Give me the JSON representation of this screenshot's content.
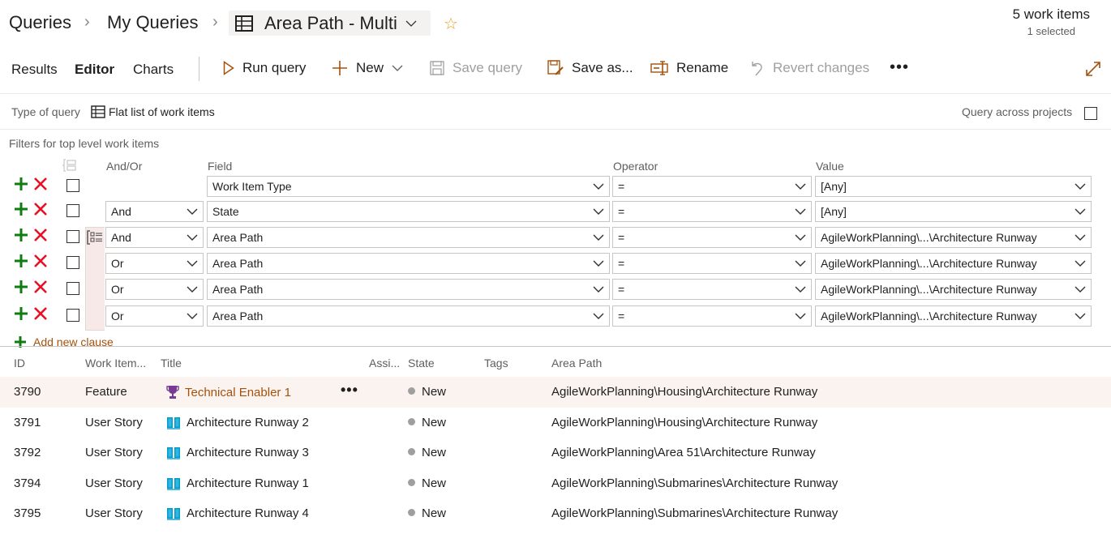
{
  "header": {
    "breadcrumb": [
      "Queries",
      "My Queries"
    ],
    "query_name": "Area Path - Multi",
    "query_icon": "table-icon",
    "favorite_icon": "star-icon",
    "work_item_count": "5 work items",
    "selected_count": "1 selected"
  },
  "toolbar": {
    "tabs": [
      {
        "label": "Results",
        "active": false
      },
      {
        "label": "Editor",
        "active": true
      },
      {
        "label": "Charts",
        "active": false
      }
    ],
    "run_query": "Run query",
    "new": "New",
    "save_query": "Save query",
    "save_as": "Save as...",
    "rename": "Rename",
    "revert_changes": "Revert changes",
    "more": "•••",
    "accent_color": "#a4510b"
  },
  "query_type": {
    "label": "Type of query",
    "value": "Flat list of work items",
    "across_projects_label": "Query across projects",
    "across_projects_checked": false
  },
  "filters": {
    "section_label": "Filters for top level work items",
    "columns": {
      "andor": "And/Or",
      "field": "Field",
      "operator": "Operator",
      "value": "Value"
    },
    "clauses": [
      {
        "andor": "",
        "field": "Work Item Type",
        "operator": "=",
        "value": "[Any]",
        "grouped": false
      },
      {
        "andor": "And",
        "field": "State",
        "operator": "=",
        "value": "[Any]",
        "grouped": false
      },
      {
        "andor": "And",
        "field": "Area Path",
        "operator": "=",
        "value": "AgileWorkPlanning\\...\\Architecture Runway",
        "grouped": true
      },
      {
        "andor": "Or",
        "field": "Area Path",
        "operator": "=",
        "value": "AgileWorkPlanning\\...\\Architecture Runway",
        "grouped": true
      },
      {
        "andor": "Or",
        "field": "Area Path",
        "operator": "=",
        "value": "AgileWorkPlanning\\...\\Architecture Runway",
        "grouped": true
      },
      {
        "andor": "Or",
        "field": "Area Path",
        "operator": "=",
        "value": "AgileWorkPlanning\\...\\Architecture Runway",
        "grouped": true
      }
    ],
    "add_clause": "Add new clause"
  },
  "results": {
    "columns": [
      "ID",
      "Work Item...",
      "Title",
      "Assi...",
      "State",
      "Tags",
      "Area Path"
    ],
    "rows": [
      {
        "id": "3790",
        "type": "Feature",
        "title": "Technical Enabler 1",
        "icon": "trophy-icon",
        "assigned": "",
        "state": "New",
        "tags": "",
        "area_path": "AgileWorkPlanning\\Housing\\Architecture Runway",
        "selected": true
      },
      {
        "id": "3791",
        "type": "User Story",
        "title": "Architecture Runway 2",
        "icon": "book-icon",
        "assigned": "",
        "state": "New",
        "tags": "",
        "area_path": "AgileWorkPlanning\\Housing\\Architecture Runway",
        "selected": false
      },
      {
        "id": "3792",
        "type": "User Story",
        "title": "Architecture Runway 3",
        "icon": "book-icon",
        "assigned": "",
        "state": "New",
        "tags": "",
        "area_path": "AgileWorkPlanning\\Area 51\\Architecture Runway",
        "selected": false
      },
      {
        "id": "3794",
        "type": "User Story",
        "title": "Architecture Runway 1",
        "icon": "book-icon",
        "assigned": "",
        "state": "New",
        "tags": "",
        "area_path": "AgileWorkPlanning\\Submarines\\Architecture Runway",
        "selected": false
      },
      {
        "id": "3795",
        "type": "User Story",
        "title": "Architecture Runway 4",
        "icon": "book-icon",
        "assigned": "",
        "state": "New",
        "tags": "",
        "area_path": "AgileWorkPlanning\\Submarines\\Architecture Runway",
        "selected": false
      }
    ],
    "row_more": "•••"
  }
}
